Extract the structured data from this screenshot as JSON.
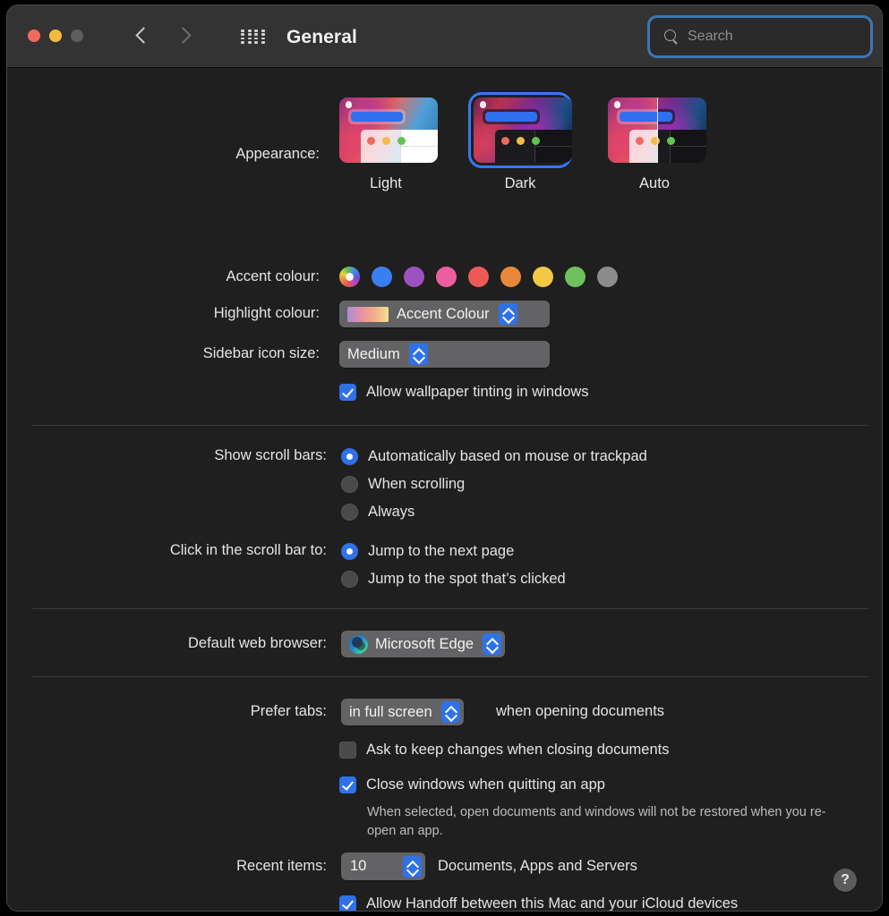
{
  "window": {
    "title": "General",
    "traffic_lights": [
      "close",
      "minimize",
      "zoom"
    ],
    "back_label": "Back",
    "forward_label": "Forward",
    "grid_label": "Show All",
    "colors": {
      "accent": "#2f72e8",
      "toolbar_bg": "#333334",
      "body_bg": "#1f1f1f",
      "focus_ring": "#3d77b5"
    }
  },
  "search": {
    "placeholder": "Search",
    "value": "",
    "icon": "search-icon"
  },
  "appearance": {
    "label": "Appearance:",
    "selected": "Dark",
    "options": [
      {
        "name": "Light"
      },
      {
        "name": "Dark"
      },
      {
        "name": "Auto"
      }
    ]
  },
  "accent_colour": {
    "label": "Accent colour:",
    "selected": "multicolour",
    "swatches": [
      {
        "name": "multicolour",
        "hex": "multi"
      },
      {
        "name": "blue",
        "hex": "#3b7ef2"
      },
      {
        "name": "purple",
        "hex": "#9b51c0"
      },
      {
        "name": "pink",
        "hex": "#ec5f9e"
      },
      {
        "name": "red",
        "hex": "#ec5a57"
      },
      {
        "name": "orange",
        "hex": "#e8883a"
      },
      {
        "name": "yellow",
        "hex": "#f2c council"
      },
      {
        "name": "green",
        "hex": "#6fc15b"
      },
      {
        "name": "graphite",
        "hex": "#8c8c8c"
      }
    ]
  },
  "highlight_colour": {
    "label": "Highlight colour:",
    "value": "Accent Colour"
  },
  "sidebar_icon_size": {
    "label": "Sidebar icon size:",
    "value": "Medium"
  },
  "wallpaper_tinting": {
    "label": "Allow wallpaper tinting in windows",
    "checked": true
  },
  "show_scroll_bars": {
    "label": "Show scroll bars:",
    "selected": "Automatically based on mouse or trackpad",
    "options": [
      "Automatically based on mouse or trackpad",
      "When scrolling",
      "Always"
    ]
  },
  "click_scroll_bar": {
    "label": "Click in the scroll bar to:",
    "selected": "Jump to the next page",
    "options": [
      "Jump to the next page",
      "Jump to the spot that’s clicked"
    ]
  },
  "default_browser": {
    "label": "Default web browser:",
    "value": "Microsoft Edge",
    "icon": "microsoft-edge-icon"
  },
  "prefer_tabs": {
    "label": "Prefer tabs:",
    "value": "in full screen",
    "suffix": "when opening documents"
  },
  "ask_keep_changes": {
    "label": "Ask to keep changes when closing documents",
    "checked": false
  },
  "close_windows": {
    "label": "Close windows when quitting an app",
    "checked": true,
    "help": "When selected, open documents and windows will not be restored when you re-open an app."
  },
  "recent_items": {
    "label": "Recent items:",
    "value": "10",
    "suffix": "Documents, Apps and Servers"
  },
  "handoff": {
    "label": "Allow Handoff between this Mac and your iCloud devices",
    "checked": true
  },
  "help_button": {
    "label": "?"
  }
}
